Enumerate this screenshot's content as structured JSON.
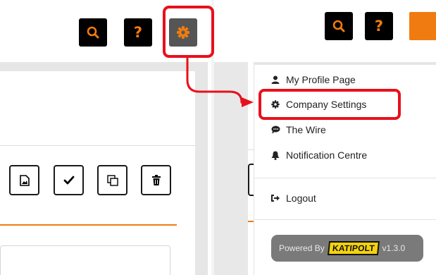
{
  "left_panel": {
    "toolbar": {
      "search_icon": "search-icon",
      "help_label": "?",
      "settings_icon": "gear-icon"
    },
    "card_actions": [
      {
        "name": "image-button",
        "icon": "🖼"
      },
      {
        "name": "confirm-button",
        "icon": "✔"
      },
      {
        "name": "duplicate-button",
        "icon": "⧉"
      },
      {
        "name": "delete-button",
        "icon": "🗑"
      }
    ]
  },
  "right_panel": {
    "toolbar": {
      "search_icon": "search-icon",
      "help_label": "?"
    },
    "menu": {
      "items": [
        {
          "label": "My Profile Page",
          "icon": "user-icon"
        },
        {
          "label": "Company Settings",
          "icon": "gear-icon"
        },
        {
          "label": "The Wire",
          "icon": "chat-icon"
        },
        {
          "label": "Notification Centre",
          "icon": "bell-icon"
        }
      ],
      "logout": {
        "label": "Logout",
        "icon": "sign-out-icon"
      },
      "powered": {
        "prefix": "Powered By",
        "brand": "KATIPOLT",
        "version": "v1.3.0"
      }
    }
  },
  "colors": {
    "accent": "#f07b10",
    "highlight": "#e8101c",
    "button_bg": "#000000",
    "settings_button_bg": "#555555"
  }
}
